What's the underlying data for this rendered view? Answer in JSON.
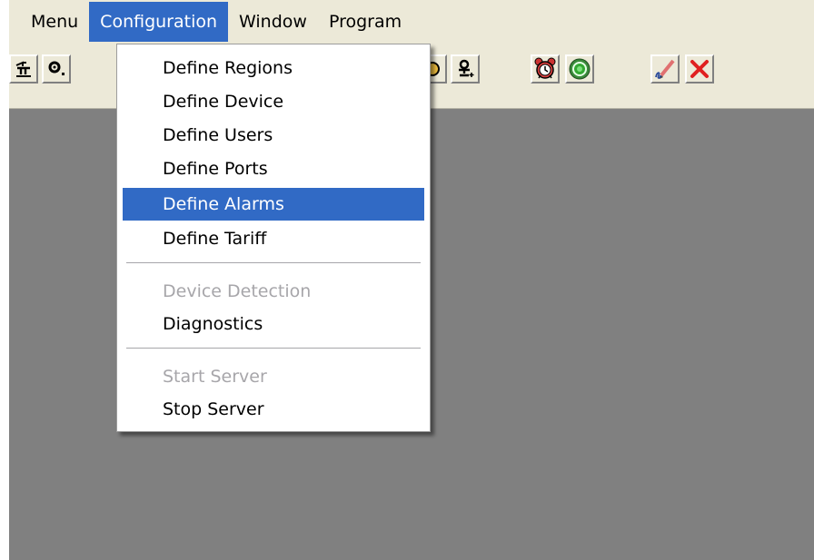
{
  "menubar": {
    "items": [
      {
        "label": "Menu"
      },
      {
        "label": "Configuration"
      },
      {
        "label": "Window"
      },
      {
        "label": "Program"
      }
    ],
    "active_index": 1
  },
  "dropdown": {
    "items": [
      {
        "label": "Define Regions",
        "state": "enabled"
      },
      {
        "label": "Define Device",
        "state": "enabled"
      },
      {
        "label": "Define Users",
        "state": "enabled"
      },
      {
        "label": "Define Ports",
        "state": "enabled"
      },
      {
        "label": "Define Alarms",
        "state": "highlighted"
      },
      {
        "label": "Define Tariff",
        "state": "enabled"
      },
      {
        "label": "Device Detection",
        "state": "disabled"
      },
      {
        "label": "Diagnostics",
        "state": "enabled"
      },
      {
        "label": "Start Server",
        "state": "disabled"
      },
      {
        "label": "Stop Server",
        "state": "enabled"
      }
    ]
  },
  "toolbar": {
    "icons": [
      "regions-icon",
      "device-icon",
      "alarm-icon",
      "user-add-icon",
      "alarm-clock-icon",
      "target-icon",
      "edit-icon",
      "close-icon"
    ]
  },
  "colors": {
    "menu_highlight": "#316ac5",
    "chrome": "#ece9d8",
    "workspace": "#808080",
    "disabled_text": "#a7a6aa"
  }
}
